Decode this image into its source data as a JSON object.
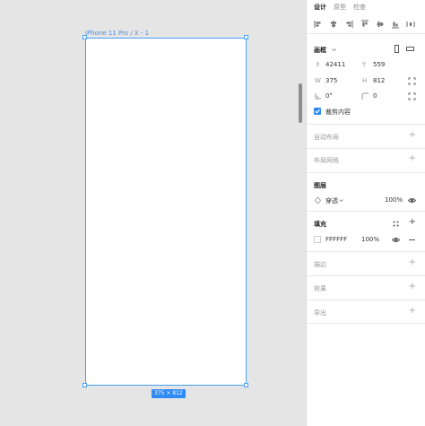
{
  "canvas": {
    "frame_label": "iPhone 11 Pro / X - 1",
    "size_badge": "375 × 812"
  },
  "panel": {
    "tabs": [
      "设计",
      "原型",
      "检查"
    ],
    "frame": {
      "title": "画框",
      "x_label": "X",
      "x_value": "42411",
      "y_label": "Y",
      "y_value": "559",
      "w_label": "W",
      "w_value": "375",
      "h_label": "H",
      "h_value": "812",
      "rotation_value": "0°",
      "radius_value": "0",
      "clip_label": "裁剪内容"
    },
    "auto_layout": {
      "title": "自动布局"
    },
    "layout_grid": {
      "title": "布局网格"
    },
    "layer": {
      "title": "图层",
      "blend_mode": "穿透",
      "opacity": "100%"
    },
    "fill": {
      "title": "填充",
      "hex": "FFFFFF",
      "opacity": "100%",
      "color": "#FFFFFF"
    },
    "stroke": {
      "title": "描边"
    },
    "effects": {
      "title": "效果"
    },
    "export": {
      "title": "导出"
    }
  },
  "colors": {
    "accent": "#2F8AF5",
    "canvas_bg": "#E5E5E5"
  }
}
